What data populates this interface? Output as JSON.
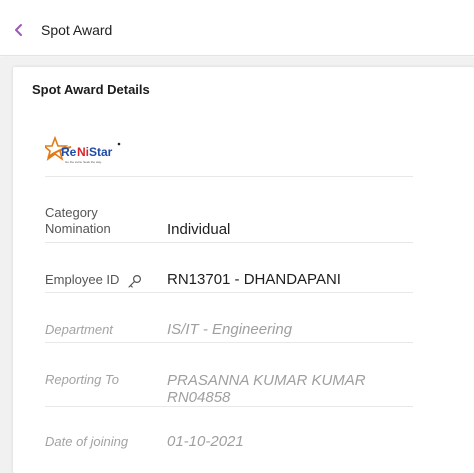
{
  "header": {
    "title": "Spot Award",
    "back_icon": "chevron-left-icon",
    "accent": "#9b59b6"
  },
  "card": {
    "title": "Spot Award Details",
    "logo_text": "ReNiStar",
    "logo_tagline": "Go the extra. Seek the way."
  },
  "fields": {
    "category_label_line1": "Category",
    "category_label_line2": "Nomination",
    "category_value": "Individual",
    "employee_label": "Employee ID",
    "employee_icon": "key-icon",
    "employee_value": "RN13701 - DHANDAPANI",
    "department_label": "Department",
    "department_value": "IS/IT - Engineering",
    "reporting_label": "Reporting To",
    "reporting_value_line1": "PRASANNA KUMAR KUMAR",
    "reporting_value_line2": "RN04858",
    "doj_label": "Date of joining",
    "doj_value": "01-10-2021"
  }
}
